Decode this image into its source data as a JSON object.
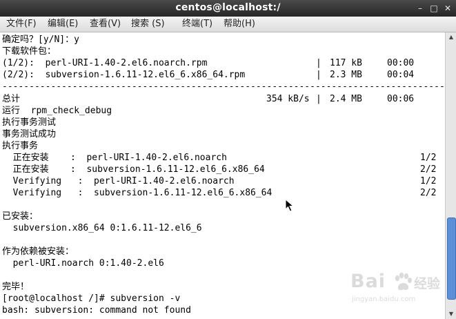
{
  "window": {
    "title": "centos@localhost:/",
    "minimize_glyph": "–",
    "maximize_glyph": "□",
    "close_glyph": "✕"
  },
  "menu": [
    {
      "label": "文件(F)"
    },
    {
      "label": "编辑(E)"
    },
    {
      "label": "查看(V)"
    },
    {
      "label": "搜索 (S)"
    },
    {
      "label": "终端(T)"
    },
    {
      "label": "帮助(H)"
    }
  ],
  "terminal": {
    "lines": [
      {
        "text": "确定吗？[y/N]：y"
      },
      {
        "text": "下载软件包："
      },
      {
        "left": "(1/2):  perl-URI-1.40-2.el6.noarch.rpm",
        "sep": "|",
        "size": "117 kB",
        "time": "00:00"
      },
      {
        "left": "(2/2):  subversion-1.6.11-12.el6_6.x86_64.rpm",
        "sep": "|",
        "size": "2.3 MB",
        "time": "00:04"
      },
      {
        "text": "------------------------------------------------------------------------------------------"
      },
      {
        "left": "总计",
        "speed": "354 kB/s",
        "sep": "|",
        "size": "2.4 MB",
        "time": "00:06"
      },
      {
        "text": "运行  rpm_check_debug"
      },
      {
        "text": "执行事务测试"
      },
      {
        "text": "事务测试成功"
      },
      {
        "text": "执行事务"
      },
      {
        "left": "  正在安装    :  perl-URI-1.40-2.el6.noarch",
        "count": "1/2"
      },
      {
        "left": "  正在安装    :  subversion-1.6.11-12.el6_6.x86_64",
        "count": "2/2"
      },
      {
        "left": "  Verifying   :  perl-URI-1.40-2.el6.noarch",
        "count": "1/2"
      },
      {
        "left": "  Verifying   :  subversion-1.6.11-12.el6_6.x86_64",
        "count": "2/2"
      },
      {
        "text": ""
      },
      {
        "text": "已安装："
      },
      {
        "text": "  subversion.x86_64 0:1.6.11-12.el6_6"
      },
      {
        "text": ""
      },
      {
        "text": "作为依赖被安装："
      },
      {
        "text": "  perl-URI.noarch 0:1.40-2.el6"
      },
      {
        "text": ""
      },
      {
        "text": "完毕！"
      },
      {
        "text": "[root@localhost /]# subversion -v"
      },
      {
        "text": "bash: subversion: command not found"
      }
    ]
  },
  "watermark": {
    "logo": "Bai",
    "logo_cn": "经验",
    "url": "jingyan.baidu.com"
  },
  "colors": {
    "titlebar": "#2f2f2f",
    "menubar": "#e4e4e4",
    "terminal_bg": "#ffffff",
    "terminal_fg": "#000000",
    "scrollbar_thumb": "#5b8fd6"
  }
}
